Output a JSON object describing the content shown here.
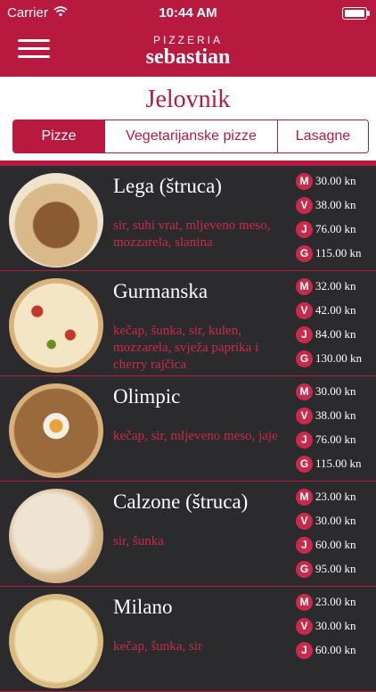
{
  "status": {
    "carrier": "Carrier",
    "time": "10:44 AM"
  },
  "header": {
    "logo_top": "PIZZERIA",
    "logo_main": "sebastian"
  },
  "page": {
    "title": "Jelovnik"
  },
  "tabs": [
    "Pizze",
    "Vegetarijanske pizze",
    "Lasagne"
  ],
  "items": [
    {
      "name": "Lega (štruca)",
      "desc": "sir, suhi vrat, mljeveno meso, mozzarela, slanina",
      "prices": [
        {
          "size": "M",
          "price": "30.00 kn"
        },
        {
          "size": "V",
          "price": "38.00 kn"
        },
        {
          "size": "J",
          "price": "76.00 kn"
        },
        {
          "size": "G",
          "price": "115.00 kn"
        }
      ]
    },
    {
      "name": "Gurmanska",
      "desc": "kečap, šunka, sir, kulen, mozzarela, svježa paprika i cherry rajčica",
      "prices": [
        {
          "size": "M",
          "price": "32.00 kn"
        },
        {
          "size": "V",
          "price": "42.00 kn"
        },
        {
          "size": "J",
          "price": "84.00 kn"
        },
        {
          "size": "G",
          "price": "130.00 kn"
        }
      ]
    },
    {
      "name": "Olimpic",
      "desc": "kečap, sir, mljeveno meso, jaje",
      "prices": [
        {
          "size": "M",
          "price": "30.00 kn"
        },
        {
          "size": "V",
          "price": "38.00 kn"
        },
        {
          "size": "J",
          "price": "76.00 kn"
        },
        {
          "size": "G",
          "price": "115.00 kn"
        }
      ]
    },
    {
      "name": "Calzone (štruca)",
      "desc": "sir, šunka",
      "prices": [
        {
          "size": "M",
          "price": "23.00 kn"
        },
        {
          "size": "V",
          "price": "30.00 kn"
        },
        {
          "size": "J",
          "price": "60.00 kn"
        },
        {
          "size": "G",
          "price": "95.00 kn"
        }
      ]
    },
    {
      "name": "Milano",
      "desc": "kečap, šunka, sir",
      "prices": [
        {
          "size": "M",
          "price": "23.00 kn"
        },
        {
          "size": "V",
          "price": "30.00 kn"
        },
        {
          "size": "J",
          "price": "60.00 kn"
        }
      ]
    }
  ],
  "colors": {
    "brand": "#b8193f",
    "badge": "#c82a4c",
    "background": "#2b2b2d"
  }
}
